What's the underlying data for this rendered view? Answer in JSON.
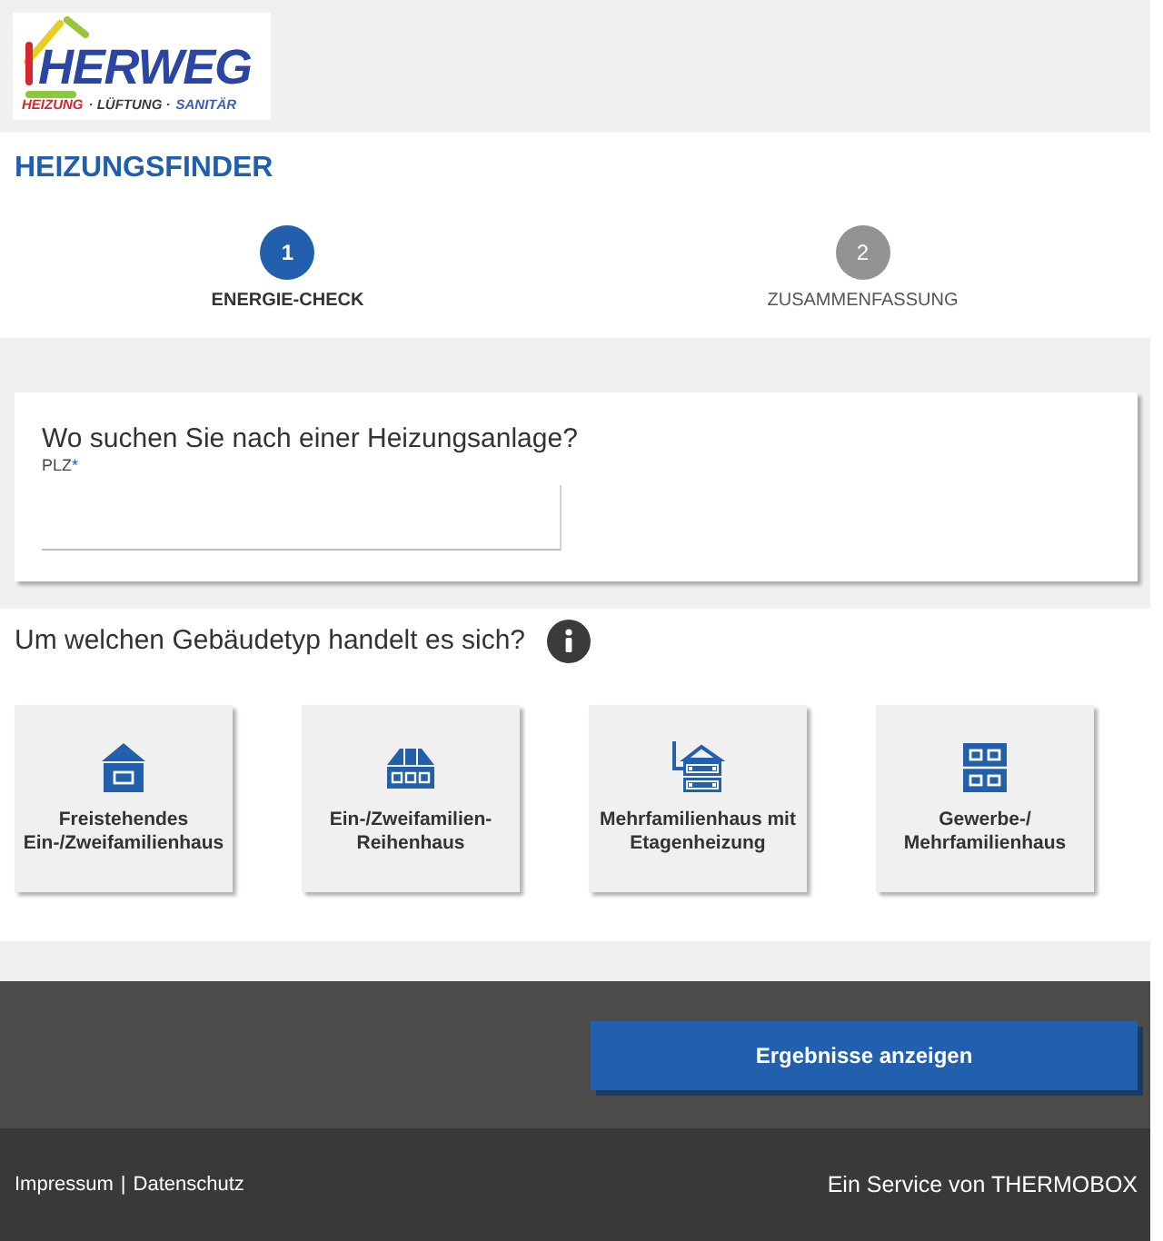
{
  "header": {
    "logo": {
      "wordmark": "HERWEG",
      "tagline": [
        {
          "text": "HEIZUNG",
          "color": "#d7262e"
        },
        {
          "text": "· LÜFTUNG ·",
          "color": "#3a3a3a"
        },
        {
          "text": "SANITÄR",
          "color": "#3b5fb5"
        }
      ]
    }
  },
  "title": "HEIZUNGSFINDER",
  "steps": [
    {
      "number": "1",
      "label": "ENERGIE-CHECK",
      "selected": true
    },
    {
      "number": "2",
      "label": "ZUSAMMENFASSUNG",
      "selected": false
    }
  ],
  "location": {
    "question": "Wo suchen Sie nach einer Heizungsanlage?",
    "field": {
      "label": "PLZ",
      "required_mark": "*"
    }
  },
  "building_type": {
    "question": "Um welchen Gebäudetyp handelt es sich?",
    "options": [
      {
        "kind": "detached",
        "label": "Freistehendes\nEin-/Zweifamilienhaus",
        "selected": false
      },
      {
        "kind": "row",
        "label": "Ein-/Zweifamilien-\nReihenhaus",
        "selected": false
      },
      {
        "kind": "apartment_heating",
        "label": "Mehrfamilienhaus mit\nEtagenheizung",
        "selected": false
      },
      {
        "kind": "commercial",
        "label": "Gewerbe-/\nMehrfamilienhaus",
        "selected": false
      }
    ]
  },
  "submit_button": "Ergebnisse anzeigen",
  "footer": {
    "links": [
      "Impressum",
      "Datenschutz"
    ],
    "separator": "|",
    "credit": "Ein Service von THERMOBOX"
  }
}
